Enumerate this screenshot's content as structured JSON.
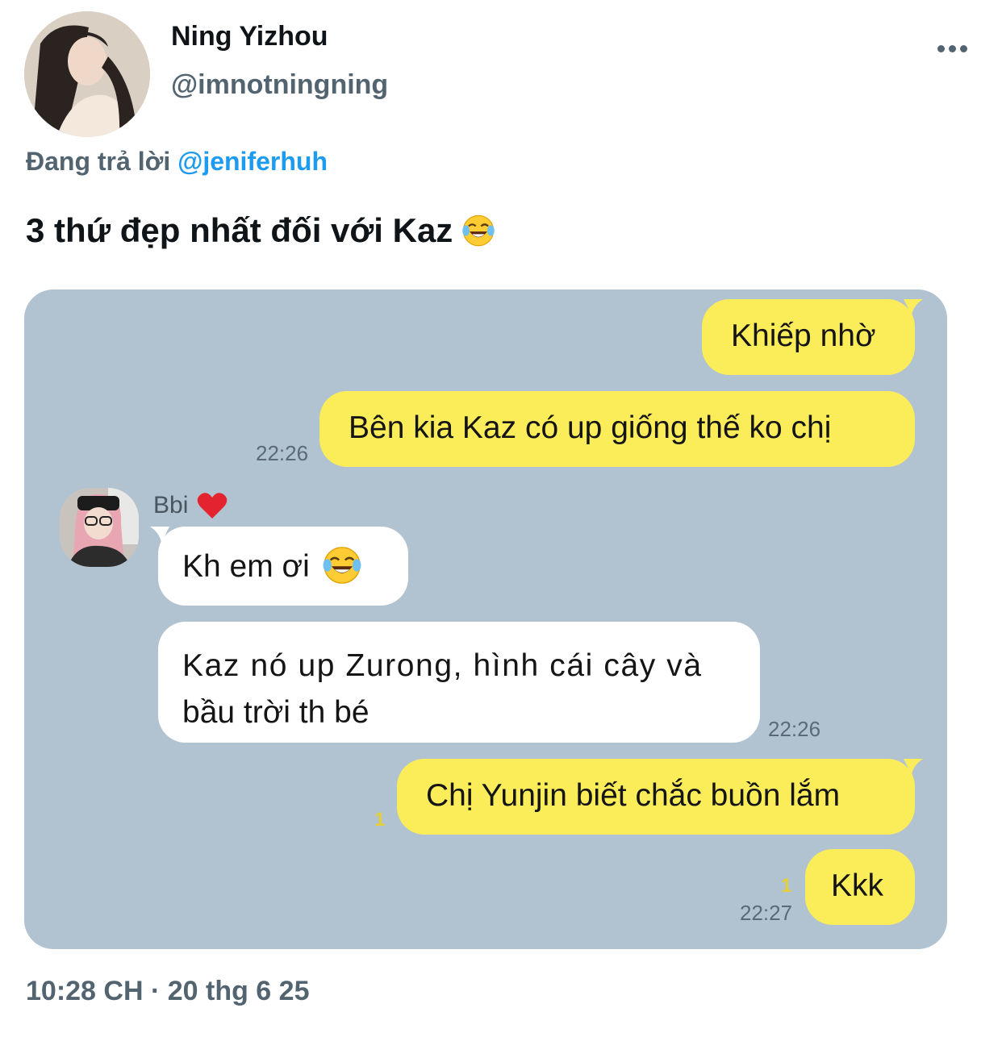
{
  "tweet": {
    "display_name": "Ning Yizhou",
    "handle": "@imnotningning",
    "replying_prefix": "Đang trả lời",
    "replying_to": "@jeniferhuh",
    "text": "3 thứ đẹp nhất đối với Kaz",
    "text_emoji": "face-with-tears-of-joy-icon",
    "timestamp": "10:28 CH · 20 thg 6 25"
  },
  "chat": {
    "friend_name": "Bbi",
    "friend_emoji": "red-heart-icon",
    "messages": [
      {
        "side": "out",
        "text": "Khiếp nhờ"
      },
      {
        "side": "out",
        "text": "Bên kia Kaz có up giống thế ko chị",
        "time": "22:26"
      },
      {
        "side": "in",
        "text": "Kh em ơi",
        "emoji": "face-with-tears-of-joy-icon"
      },
      {
        "side": "in",
        "line1": "Kaz nó up Zurong, hình cái cây và",
        "line2": "bầu trời th bé",
        "time": "22:26"
      },
      {
        "side": "out",
        "text": "Chị Yunjin biết chắc buồn lắm",
        "unread": "1"
      },
      {
        "side": "out",
        "text": "Kkk",
        "unread": "1",
        "time": "22:27"
      }
    ]
  },
  "colors": {
    "chat_background": "#b1c2d0",
    "outgoing_bubble": "#fbec59",
    "incoming_bubble": "#ffffff",
    "mention": "#1d9bf0",
    "secondary_text": "#536471"
  }
}
